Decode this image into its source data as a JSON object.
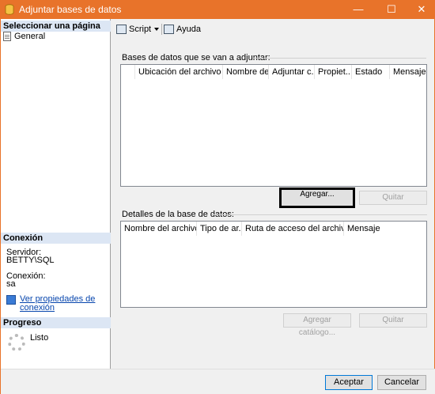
{
  "window": {
    "title": "Adjuntar bases de datos",
    "minimize_glyph": "—",
    "maximize_glyph": "☐",
    "close_glyph": "✕"
  },
  "left": {
    "select_page_header": "Seleccionar una página",
    "pages": [
      {
        "label": "General",
        "icon": "page-icon"
      }
    ],
    "connection_header": "Conexión",
    "server_label": "Servidor:",
    "server_value": "BETTY\\SQL",
    "connection_label": "Conexión:",
    "connection_value": "sa",
    "view_props_link_line1": "Ver propiedades de",
    "view_props_link_line2": "conexión",
    "progress_header": "Progreso",
    "progress_status": "Listo"
  },
  "toolbar": {
    "script_label": "Script",
    "help_label": "Ayuda"
  },
  "databases": {
    "group_label": "Bases de datos que se van a adjuntar:",
    "columns": [
      "",
      "Ubicación del archivo M...",
      "Nombre de...",
      "Adjuntar c...",
      "Propiet...",
      "Estado",
      "Mensaje"
    ],
    "add_button": "Agregar...",
    "remove_button": "Quitar"
  },
  "details": {
    "group_label": "Detalles de la base de datos:",
    "columns": [
      "Nombre del archivo ...",
      "Tipo de ar...",
      "Ruta de acceso del archivo a...",
      "Mensaje"
    ],
    "add_catalog_button": "Agregar catálogo...",
    "remove_button": "Quitar"
  },
  "footer": {
    "accept_button": "Aceptar",
    "cancel_button": "Cancelar"
  },
  "colors": {
    "titlebar": "#e8732a",
    "section_header": "#dce6f4",
    "link": "#0645ad"
  }
}
